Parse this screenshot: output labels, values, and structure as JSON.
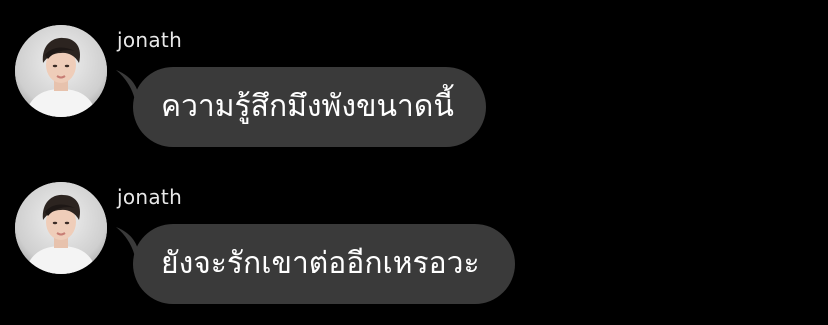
{
  "messages": [
    {
      "sender": "jonath",
      "avatar_icon": "user-avatar-photo",
      "text": "ความรู้สึกมึงพังขนาดนี้"
    },
    {
      "sender": "jonath",
      "avatar_icon": "user-avatar-photo",
      "text": "ยังจะรักเขาต่ออีกเหรอวะ"
    }
  ],
  "colors": {
    "background": "#000000",
    "bubble": "#3a3a3a",
    "message_text": "#ffffff",
    "sender_text": "#e8e8e8"
  }
}
